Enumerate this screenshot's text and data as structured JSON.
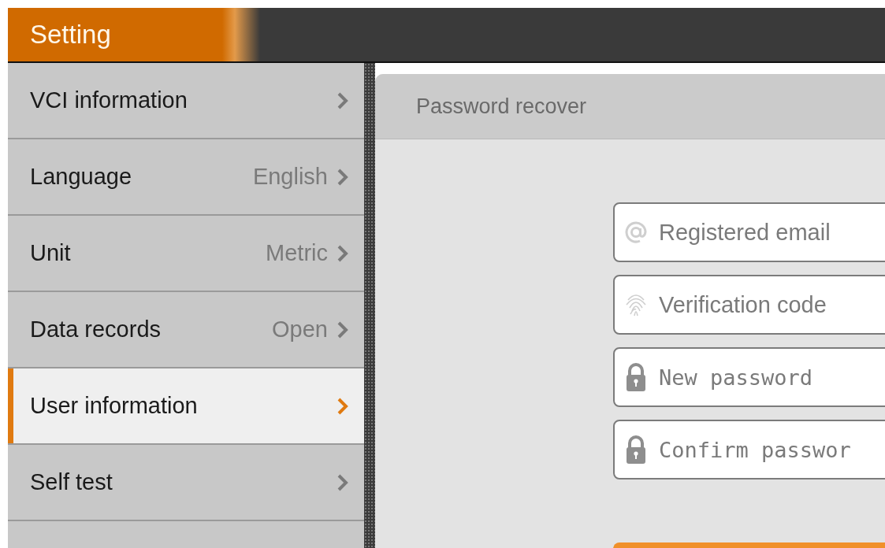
{
  "header": {
    "title": "Setting"
  },
  "sidebar": {
    "items": [
      {
        "label": "VCI information",
        "selected": false
      },
      {
        "label": "Language",
        "value": "English",
        "selected": false
      },
      {
        "label": "Unit",
        "value": "Metric",
        "selected": false
      },
      {
        "label": "Data records",
        "value": "Open",
        "selected": false
      },
      {
        "label": "User information",
        "selected": true
      },
      {
        "label": "Self test",
        "selected": false
      }
    ]
  },
  "panel": {
    "title": "Password recover",
    "fields": [
      {
        "kind": "email",
        "placeholder": "Registered email"
      },
      {
        "kind": "code",
        "placeholder": "Verification code"
      },
      {
        "kind": "password",
        "placeholder": "New password"
      },
      {
        "kind": "password",
        "placeholder": "Confirm passwor"
      }
    ]
  }
}
